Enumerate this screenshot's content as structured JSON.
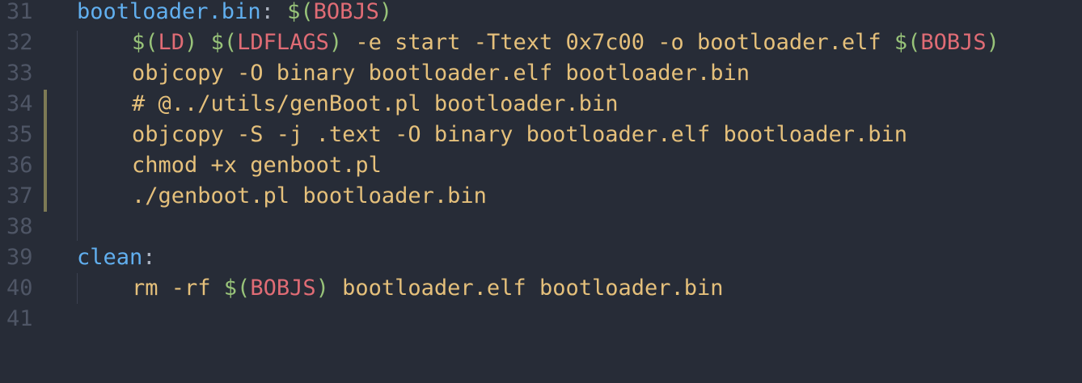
{
  "editor": {
    "lines": [
      {
        "num": "31",
        "parts": [
          {
            "t": "bootloader.bin",
            "c": "target"
          },
          {
            "t": ": ",
            "c": "punct"
          },
          {
            "t": "$(",
            "c": "dollar"
          },
          {
            "t": "BOBJS",
            "c": "var"
          },
          {
            "t": ")",
            "c": "dollar"
          }
        ]
      },
      {
        "num": "32",
        "indent": true,
        "parts": [
          {
            "t": "$(",
            "c": "dollar"
          },
          {
            "t": "LD",
            "c": "var"
          },
          {
            "t": ")",
            "c": "dollar"
          },
          {
            "t": " ",
            "c": "cmd"
          },
          {
            "t": "$(",
            "c": "dollar"
          },
          {
            "t": "LDFLAGS",
            "c": "var"
          },
          {
            "t": ")",
            "c": "dollar"
          },
          {
            "t": " -e start -Ttext 0x7c00 -o bootloader.elf ",
            "c": "cmd"
          },
          {
            "t": "$(",
            "c": "dollar"
          },
          {
            "t": "BOBJS",
            "c": "var"
          },
          {
            "t": ")",
            "c": "dollar"
          }
        ]
      },
      {
        "num": "33",
        "indent": true,
        "parts": [
          {
            "t": "objcopy -O binary bootloader.elf bootloader.bin",
            "c": "cmd"
          }
        ]
      },
      {
        "num": "34",
        "indent": true,
        "parts": [
          {
            "t": "# @../utils/genBoot.pl bootloader.bin",
            "c": "comment"
          }
        ]
      },
      {
        "num": "35",
        "indent": true,
        "parts": [
          {
            "t": "objcopy -S -j .text -O binary bootloader.elf bootloader.bin",
            "c": "cmd"
          }
        ]
      },
      {
        "num": "36",
        "indent": true,
        "parts": [
          {
            "t": "chmod +x genboot.pl",
            "c": "cmd"
          }
        ]
      },
      {
        "num": "37",
        "indent": true,
        "parts": [
          {
            "t": "./genboot.pl bootloader.bin",
            "c": "cmd"
          }
        ]
      },
      {
        "num": "38",
        "parts": []
      },
      {
        "num": "39",
        "parts": [
          {
            "t": "clean",
            "c": "target"
          },
          {
            "t": ":",
            "c": "punct"
          }
        ]
      },
      {
        "num": "40",
        "indent": true,
        "parts": [
          {
            "t": "rm -rf ",
            "c": "cmd"
          },
          {
            "t": "$(",
            "c": "dollar"
          },
          {
            "t": "BOBJS",
            "c": "var"
          },
          {
            "t": ")",
            "c": "dollar"
          },
          {
            "t": " bootloader.elf bootloader.bin",
            "c": "cmd"
          }
        ]
      },
      {
        "num": "41",
        "parts": []
      }
    ]
  },
  "colors": {
    "background": "#272c37",
    "line_number": "#4f5666",
    "target": "#61afef",
    "variable": "#e06c75",
    "dollar_paren": "#98c379",
    "text": "#e5c07b",
    "modified_marker": "#7d7a55"
  }
}
